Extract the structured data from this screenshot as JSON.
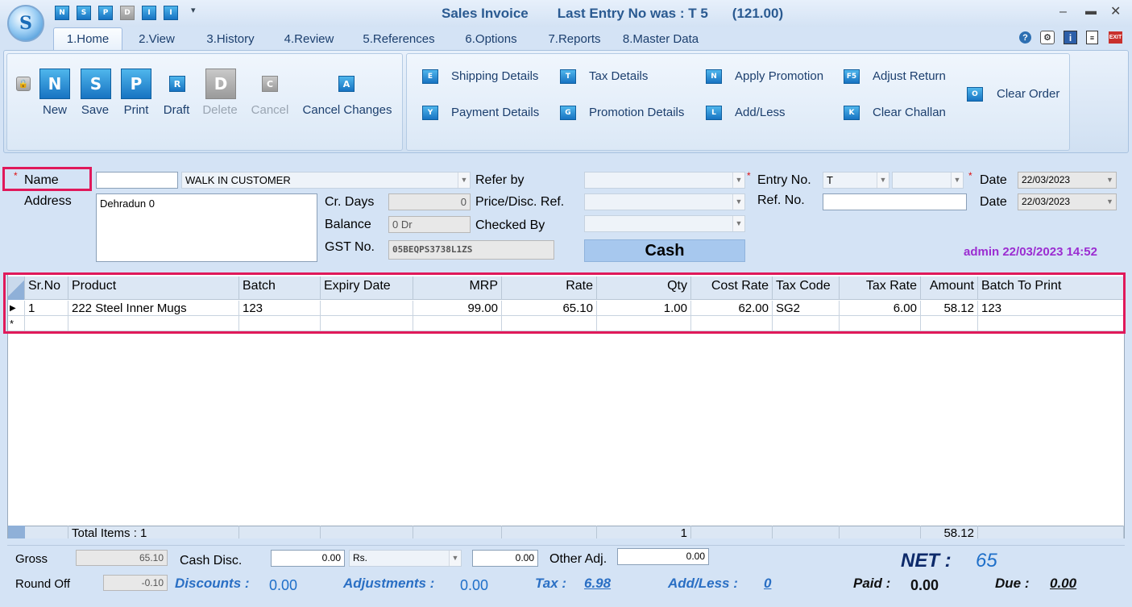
{
  "window": {
    "title": "Sales Invoice",
    "last_entry": "Last Entry No was : T 5",
    "amount": "(121.00)"
  },
  "qat": [
    "N",
    "S",
    "P",
    "D",
    "I",
    "I"
  ],
  "tabs": [
    {
      "label": "1.Home"
    },
    {
      "label": "2.View"
    },
    {
      "label": "3.History"
    },
    {
      "label": "4.Review"
    },
    {
      "label": "5.References"
    },
    {
      "label": "6.Options"
    },
    {
      "label": "7.Reports"
    },
    {
      "label": "8.Master Data"
    }
  ],
  "ribbon": {
    "main": [
      {
        "label": "New",
        "glyph": "N",
        "enabled": true
      },
      {
        "label": "Save",
        "glyph": "S",
        "enabled": true
      },
      {
        "label": "Print",
        "glyph": "P",
        "enabled": true
      },
      {
        "label": "Draft",
        "glyph": "R",
        "enabled": true
      },
      {
        "label": "Delete",
        "glyph": "D",
        "enabled": false
      },
      {
        "label": "Cancel",
        "glyph": "C",
        "enabled": false
      },
      {
        "label": "Cancel Changes",
        "glyph": "A",
        "enabled": true
      }
    ],
    "actions": [
      {
        "label": "Shipping Details",
        "glyph": "E"
      },
      {
        "label": "Payment Details",
        "glyph": "Y"
      },
      {
        "label": "Tax Details",
        "glyph": "T"
      },
      {
        "label": "Promotion Details",
        "glyph": "G"
      },
      {
        "label": "Apply Promotion",
        "glyph": "N"
      },
      {
        "label": "Add/Less",
        "glyph": "L"
      },
      {
        "label": "Adjust Return",
        "glyph": "F5"
      },
      {
        "label": "Clear Challan",
        "glyph": "K"
      },
      {
        "label": "Clear Order",
        "glyph": "O"
      }
    ]
  },
  "form": {
    "name_label": "Name",
    "name_code": "",
    "customer": "WALK IN CUSTOMER",
    "address_label": "Address",
    "address": "Dehradun 0",
    "cr_days_label": "Cr. Days",
    "cr_days": "0",
    "balance_label": "Balance",
    "balance": "0 Dr",
    "gst_label": "GST No.",
    "gst": "05BEQPS3738L1ZS",
    "refer_by_label": "Refer by",
    "price_ref_label": "Price/Disc. Ref.",
    "checked_by_label": "Checked By",
    "cash_label": "Cash",
    "entry_no_label": "Entry No.",
    "entry_no": "T",
    "ref_no_label": "Ref. No.",
    "date_label": "Date",
    "date1": "22/03/2023",
    "date2": "22/03/2023",
    "user_stamp": "admin 22/03/2023 14:52",
    "asterisk": "*"
  },
  "grid": {
    "columns": [
      "Sr.No",
      "Product",
      "Batch",
      "Expiry Date",
      "MRP",
      "Rate",
      "Qty",
      "Cost Rate",
      "Tax Code",
      "Tax Rate",
      "Amount",
      "Batch To Print"
    ],
    "rows": [
      [
        "1",
        "222 Steel Inner Mugs",
        "123",
        "",
        "99.00",
        "65.10",
        "1.00",
        "62.00",
        "SG2",
        "6.00",
        "58.12",
        "123"
      ]
    ],
    "total_label": "Total Items : 1",
    "total_qty": "1",
    "total_amount": "58.12"
  },
  "footer": {
    "gross_label": "Gross",
    "gross": "65.10",
    "round_off_label": "Round Off",
    "round_off": "-0.10",
    "cash_disc_label": "Cash Disc.",
    "cash_disc": "0.00",
    "cash_disc_type": "Rs.",
    "cash_disc_amt": "0.00",
    "other_adj_label": "Other Adj.",
    "other_adj": "0.00",
    "net_label": "NET :",
    "net": "65",
    "discounts_label": "Discounts :",
    "discounts": "0.00",
    "adjustments_label": "Adjustments :",
    "adjustments": "0.00",
    "tax_label": "Tax :",
    "tax": "6.98",
    "addless_label": "Add/Less :",
    "addless": "0",
    "paid_label": "Paid :",
    "paid": "0.00",
    "due_label": "Due :",
    "due": "0.00"
  }
}
